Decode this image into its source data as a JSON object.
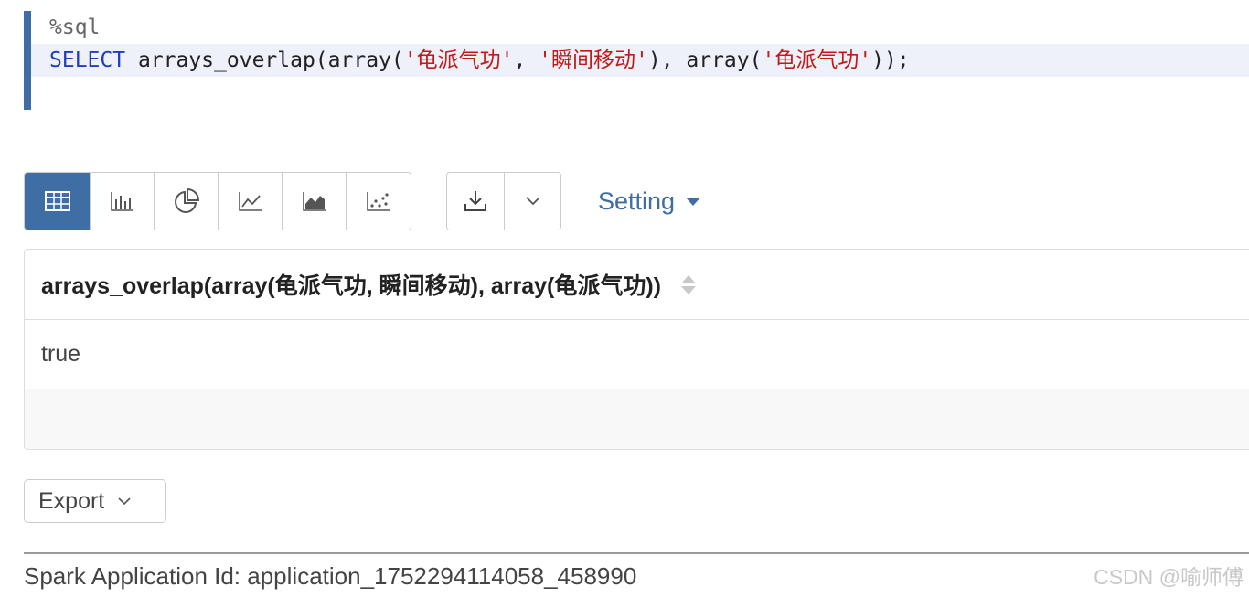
{
  "editor": {
    "line1": "%sql",
    "line2": {
      "keyword": "SELECT",
      "fn": " arrays_overlap(array(",
      "str1": "'龟派气功'",
      "sep1": ", ",
      "str2": "'瞬间移动'",
      "mid": "), array(",
      "str3": "'龟派气功'",
      "end": "));"
    }
  },
  "toolbar": {
    "viz_buttons": [
      "table-icon",
      "bar-chart-icon",
      "pie-chart-icon",
      "line-chart-icon",
      "area-chart-icon",
      "scatter-chart-icon"
    ],
    "active": "table-icon",
    "download_icon": "download-icon",
    "dropdown_icon": "chevron-down-icon",
    "setting_label": "Setting"
  },
  "result": {
    "column_header": "arrays_overlap(array(龟派气功, 瞬间移动), array(龟派气功))",
    "rows": [
      "true"
    ]
  },
  "export": {
    "label": "Export"
  },
  "footer": {
    "text": "Spark Application Id: application_1752294114058_458990",
    "watermark": "CSDN @喻师傅"
  },
  "colors": {
    "accent": "#3e6ea3",
    "keyword": "#1f3fb8",
    "string": "#c41a16"
  }
}
